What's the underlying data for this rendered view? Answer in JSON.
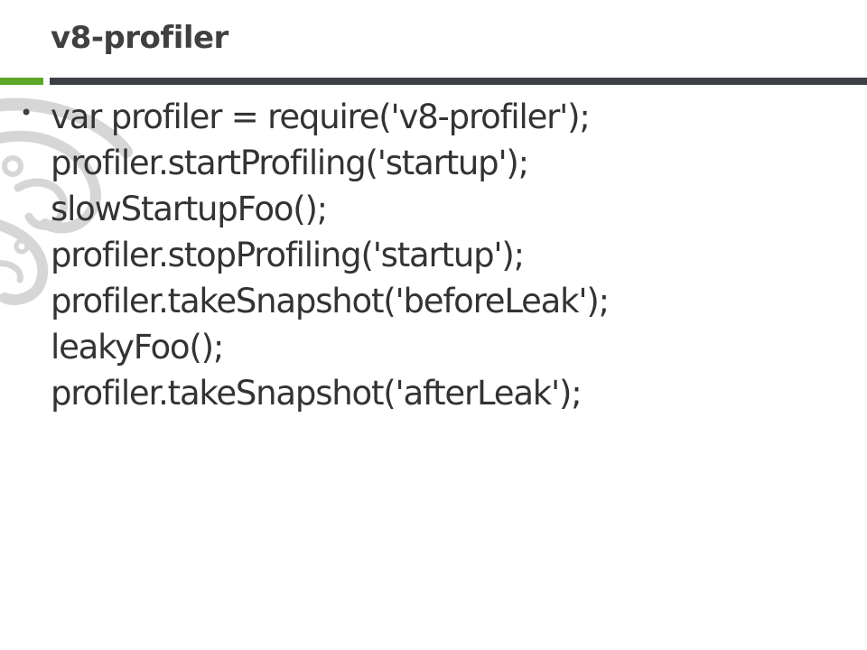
{
  "slide": {
    "title": "v8-profiler",
    "bullet_marker": "•",
    "code_lines": [
      "var profiler = require('v8-profiler');",
      "profiler.startProfiling('startup');",
      "slowStartupFoo();",
      "profiler.stopProfiling('startup');",
      "profiler.takeSnapshot('beforeLeak');",
      "leakyFoo();",
      "profiler.takeSnapshot('afterLeak');"
    ]
  },
  "colors": {
    "accent_green": "#5ba829",
    "rule_dark": "#3d4147",
    "title_text": "#404040",
    "body_text": "#333333",
    "decoration_gray": "#d6d6d6"
  },
  "icons": {
    "decoration": "swirl-decoration-icon"
  }
}
